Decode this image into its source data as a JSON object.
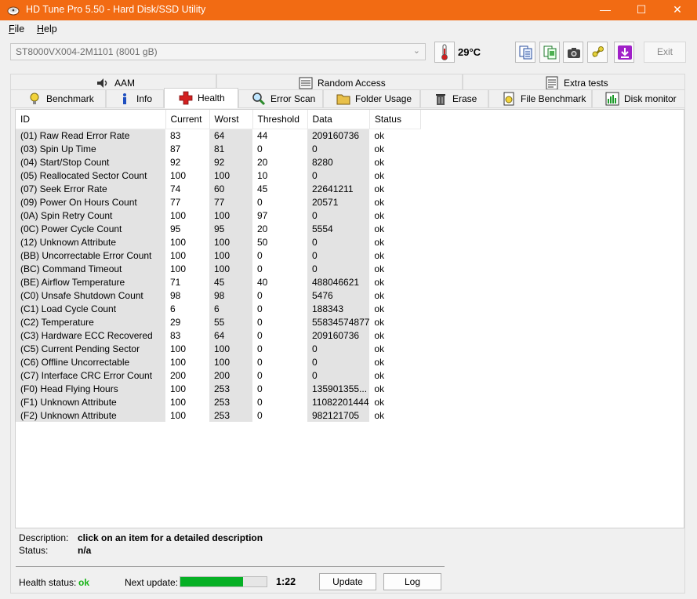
{
  "window": {
    "title": "HD Tune Pro 5.50 - Hard Disk/SSD Utility",
    "controls": {
      "minimize": "—",
      "maximize": "☐",
      "close": "✕"
    }
  },
  "menu": [
    {
      "first": "F",
      "rest": "ile"
    },
    {
      "first": "H",
      "rest": "elp"
    }
  ],
  "toolbar": {
    "drive": "ST8000VX004-2M1101 (8001 gB)",
    "temperature": "29°C",
    "exit_label": "Exit"
  },
  "tabs_row1": [
    {
      "label": "AAM",
      "icon": "speaker-icon"
    },
    {
      "label": "Random Access",
      "icon": "random-access-icon"
    },
    {
      "label": "Extra tests",
      "icon": "extra-tests-icon"
    }
  ],
  "tabs_row2": [
    {
      "label": "Benchmark",
      "icon": "benchmark-icon"
    },
    {
      "label": "Info",
      "icon": "info-icon"
    },
    {
      "label": "Health",
      "icon": "health-cross-icon",
      "active": true
    },
    {
      "label": "Error Scan",
      "icon": "magnifier-icon"
    },
    {
      "label": "Folder Usage",
      "icon": "folder-icon"
    },
    {
      "label": "Erase",
      "icon": "trash-icon"
    },
    {
      "label": "File Benchmark",
      "icon": "file-benchmark-icon"
    },
    {
      "label": "Disk monitor",
      "icon": "disk-monitor-icon"
    }
  ],
  "table": {
    "headers": [
      "ID",
      "Current",
      "Worst",
      "Threshold",
      "Data",
      "Status"
    ],
    "rows": [
      [
        "(01) Raw Read Error Rate",
        "83",
        "64",
        "44",
        "209160736",
        "ok"
      ],
      [
        "(03) Spin Up Time",
        "87",
        "81",
        "0",
        "0",
        "ok"
      ],
      [
        "(04) Start/Stop Count",
        "92",
        "92",
        "20",
        "8280",
        "ok"
      ],
      [
        "(05) Reallocated Sector Count",
        "100",
        "100",
        "10",
        "0",
        "ok"
      ],
      [
        "(07) Seek Error Rate",
        "74",
        "60",
        "45",
        "22641211",
        "ok"
      ],
      [
        "(09) Power On Hours Count",
        "77",
        "77",
        "0",
        "20571",
        "ok"
      ],
      [
        "(0A) Spin Retry Count",
        "100",
        "100",
        "97",
        "0",
        "ok"
      ],
      [
        "(0C) Power Cycle Count",
        "95",
        "95",
        "20",
        "5554",
        "ok"
      ],
      [
        "(12) Unknown Attribute",
        "100",
        "100",
        "50",
        "0",
        "ok"
      ],
      [
        "(BB) Uncorrectable Error Count",
        "100",
        "100",
        "0",
        "0",
        "ok"
      ],
      [
        "(BC) Command Timeout",
        "100",
        "100",
        "0",
        "0",
        "ok"
      ],
      [
        "(BE) Airflow Temperature",
        "71",
        "45",
        "40",
        "488046621",
        "ok"
      ],
      [
        "(C0) Unsafe Shutdown Count",
        "98",
        "98",
        "0",
        "5476",
        "ok"
      ],
      [
        "(C1) Load Cycle Count",
        "6",
        "6",
        "0",
        "188343",
        "ok"
      ],
      [
        "(C2) Temperature",
        "29",
        "55",
        "0",
        "55834574877",
        "ok"
      ],
      [
        "(C3) Hardware ECC Recovered",
        "83",
        "64",
        "0",
        "209160736",
        "ok"
      ],
      [
        "(C5) Current Pending Sector",
        "100",
        "100",
        "0",
        "0",
        "ok"
      ],
      [
        "(C6) Offline Uncorrectable",
        "100",
        "100",
        "0",
        "0",
        "ok"
      ],
      [
        "(C7) Interface CRC Error Count",
        "200",
        "200",
        "0",
        "0",
        "ok"
      ],
      [
        "(F0) Head Flying Hours",
        "100",
        "253",
        "0",
        "135901355...",
        "ok"
      ],
      [
        "(F1) Unknown Attribute",
        "100",
        "253",
        "0",
        "11082201444",
        "ok"
      ],
      [
        "(F2) Unknown Attribute",
        "100",
        "253",
        "0",
        "982121705",
        "ok"
      ]
    ]
  },
  "details": {
    "description_label": "Description:",
    "description_value": "click on an item for a detailed description",
    "status_label": "Status:",
    "status_value": "n/a"
  },
  "footer": {
    "health_label": "Health status:",
    "health_value": "ok",
    "next_update_label": "Next update:",
    "next_update_progress": 0.73,
    "next_update_time": "1:22",
    "update_button": "Update",
    "log_button": "Log"
  },
  "colors": {
    "titlebar": "#f26b13",
    "health_ok": "#18b418",
    "progress_fill": "#06b025"
  }
}
